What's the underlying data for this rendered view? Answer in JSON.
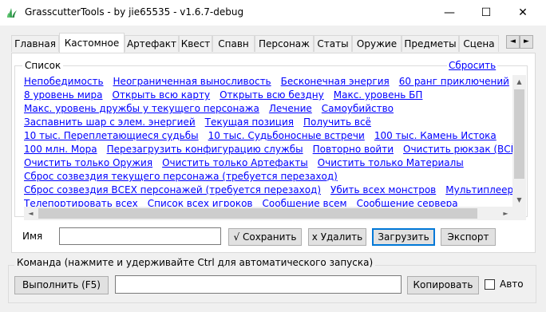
{
  "window": {
    "title": "GrasscutterTools  - by jie65535  - v1.6.7-debug",
    "minimize": "—",
    "maximize": "☐",
    "close": "✕"
  },
  "tabs": [
    {
      "label": "Главная",
      "active": false
    },
    {
      "label": "Кастомное",
      "active": true
    },
    {
      "label": "Артефакт",
      "active": false
    },
    {
      "label": "Квест",
      "active": false
    },
    {
      "label": "Спавн",
      "active": false
    },
    {
      "label": "Персонаж",
      "active": false
    },
    {
      "label": "Статы",
      "active": false
    },
    {
      "label": "Оружие",
      "active": false
    },
    {
      "label": "Предметы",
      "active": false
    },
    {
      "label": "Сцена",
      "active": false
    }
  ],
  "tab_scroll": {
    "left": "◄",
    "right": "►"
  },
  "custom": {
    "legend": "Список",
    "reset_label": "Сбросить",
    "commands": [
      [
        "Непобедимость",
        "Неограниченная выносливость",
        "Бесконечная энергия",
        "60 ранг приключений"
      ],
      [
        "8 уровень мира",
        "Открыть всю карту",
        "Открыть всю бездну",
        "Макс. уровень БП"
      ],
      [
        "Макс. уровень дружбы у текущего персонажа",
        "Лечение",
        "Самоубийство"
      ],
      [
        "Заспавнить шар с элем. энергией",
        "Текущая позиция",
        "Получить всё"
      ],
      [
        "10 тыс. Переплетающиеся судьбы",
        "10 тыс. Судьбоносные встречи",
        "100 тыс. Камень Истока"
      ],
      [
        "100 млн. Мора",
        "Перезагрузить конфигурацию службы",
        "Повторно войти",
        "Очистить рюкзак (ВСЁ)"
      ],
      [
        "Очистить только Оружия",
        "Очистить только Артефакты",
        "Очистить только Материалы"
      ],
      [
        "Сброс созвездия текущего персонажа (требуется перезаход)"
      ],
      [
        "Сброс созвездия ВСЕХ персонажей (требуется перезаход)",
        "Убить всех монстров",
        "Мультиплеер"
      ],
      [
        "Телепортировать всех",
        "Список всех игроков",
        "Сообщение всем",
        "Сообщение сервера"
      ]
    ],
    "name_label": "Имя",
    "name_value": "",
    "save_label": "√ Сохранить",
    "delete_label": "x Удалить",
    "load_label": "Загрузить",
    "export_label": "Экспорт"
  },
  "command_bar": {
    "legend": "Команда (нажмите и удерживайте Ctrl для автоматического запуска)",
    "run_label": "Выполнить (F5)",
    "command_value": "",
    "copy_label": "Копировать",
    "auto_label": "Авто",
    "auto_checked": false
  }
}
